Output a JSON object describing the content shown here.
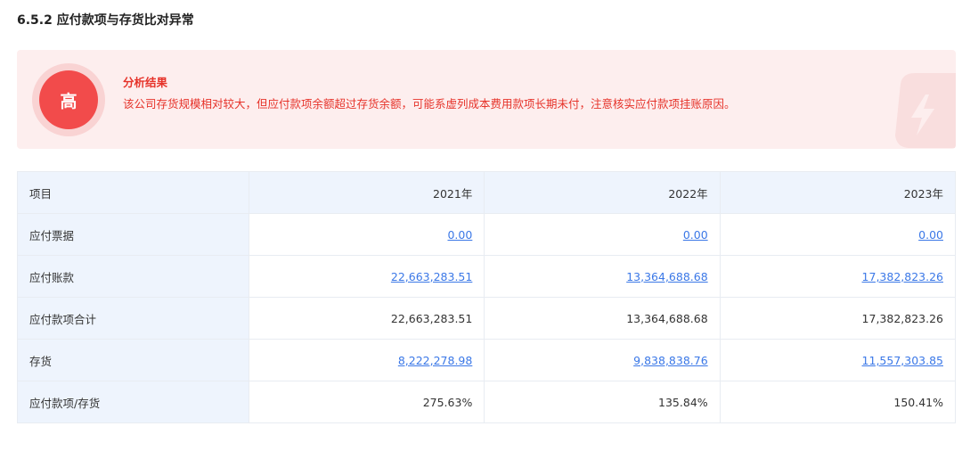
{
  "section": {
    "title": "6.5.2 应付款项与存货比对异常"
  },
  "alert": {
    "risk_level": "高",
    "title": "分析结果",
    "text": "该公司存货规模相对较大，但应付款项余额超过存货余额，可能系虚列成本费用款项长期未付，注意核实应付款项挂账原因。",
    "colors": {
      "background": "#fdeeee",
      "badge": "#f24b4b",
      "text": "#e6332a"
    }
  },
  "table": {
    "headers": [
      "项目",
      "2021年",
      "2022年",
      "2023年"
    ],
    "rows": [
      {
        "label": "应付票据",
        "values": [
          "0.00",
          "0.00",
          "0.00"
        ],
        "link": true
      },
      {
        "label": "应付账款",
        "values": [
          "22,663,283.51",
          "13,364,688.68",
          "17,382,823.26"
        ],
        "link": true
      },
      {
        "label": "应付款项合计",
        "values": [
          "22,663,283.51",
          "13,364,688.68",
          "17,382,823.26"
        ],
        "link": false
      },
      {
        "label": "存货",
        "values": [
          "8,222,278.98",
          "9,838,838.76",
          "11,557,303.85"
        ],
        "link": true
      },
      {
        "label": "应付款项/存货",
        "values": [
          "275.63%",
          "135.84%",
          "150.41%"
        ],
        "link": false
      }
    ],
    "colors": {
      "header_bg": "#eef4fd",
      "link": "#3b78e7",
      "border": "#e8ecf2"
    }
  }
}
